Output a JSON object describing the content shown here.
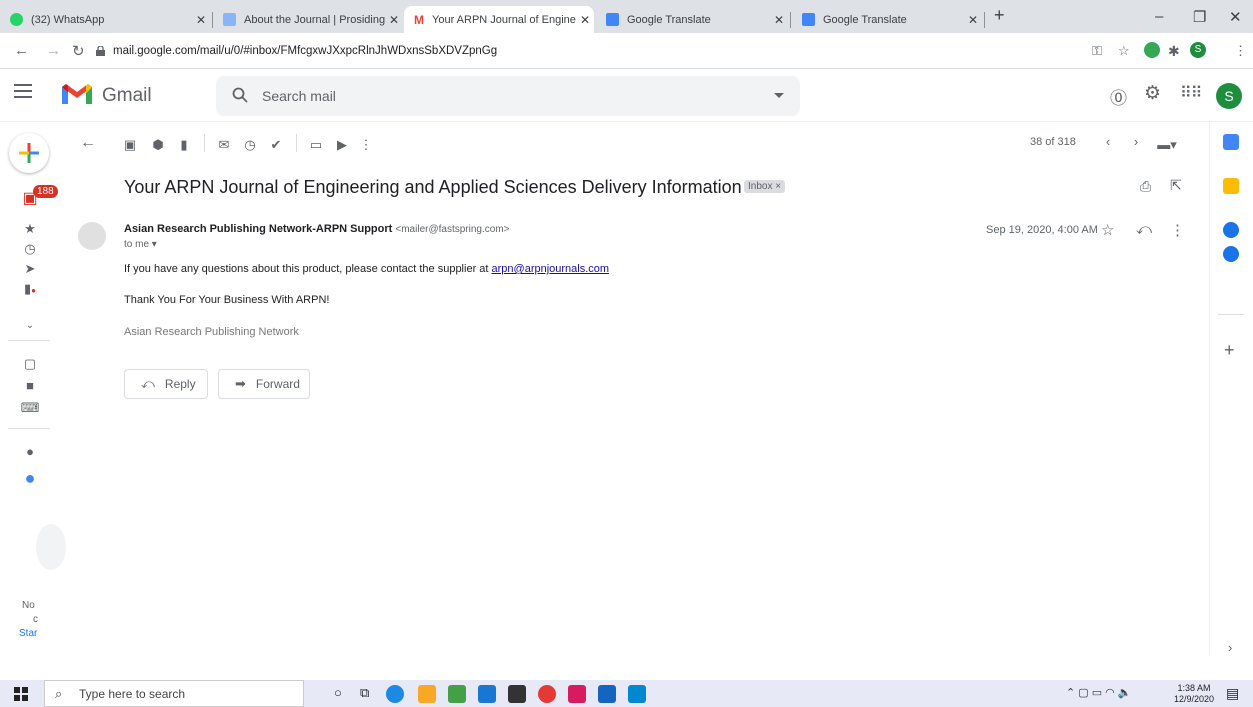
{
  "browser": {
    "tabs": [
      {
        "label": "(32) WhatsApp",
        "active": false,
        "color": "#25d366"
      },
      {
        "label": "About the Journal | Prosiding Sei",
        "active": false,
        "color": "#8ab4f8"
      },
      {
        "label": "Your ARPN Journal of Engineerin",
        "active": true,
        "color": "#ea4335"
      },
      {
        "label": "Google Translate",
        "active": false,
        "color": "#4285f4"
      },
      {
        "label": "Google Translate",
        "active": false,
        "color": "#4285f4"
      }
    ],
    "url": "mail.google.com/mail/u/0/#inbox/FMfcgxwJXxpcRlnJhWDxnsSbXDVZpnGg",
    "profile_initial": "S"
  },
  "gmail": {
    "brand": "Gmail",
    "search_placeholder": "Search mail",
    "avatar_initial": "S",
    "inbox_count": "188",
    "pager": "38 of 318",
    "rail_text": [
      "No",
      "c",
      "Star"
    ]
  },
  "message": {
    "subject": "Your ARPN Journal of Engineering and Applied Sciences Delivery Information",
    "label": "Inbox ×",
    "sender_name": "Asian Research Publishing Network-ARPN Support",
    "sender_email": "<mailer@fastspring.com>",
    "to": "to me",
    "date": "Sep 19, 2020, 4:00 AM",
    "body_line1": "If you have any questions about this product, please contact the supplier at ",
    "body_link": "arpn@arpnjournals.com",
    "body_line2": "Thank You For Your Business With ARPN!",
    "signature": "Asian Research Publishing Network",
    "reply_label": "Reply",
    "forward_label": "Forward"
  },
  "taskbar": {
    "search_placeholder": "Type here to search",
    "time": "1:38 AM",
    "date": "12/9/2020"
  }
}
